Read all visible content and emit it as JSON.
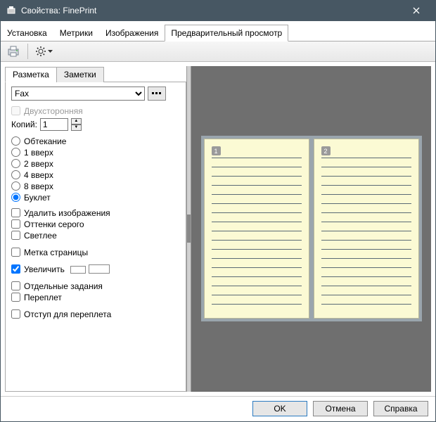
{
  "titlebar": {
    "title": "Свойства: FinePrint"
  },
  "tabs": {
    "install": "Установка",
    "metrics": "Метрики",
    "images": "Изображения",
    "preview": "Предварительный просмотр"
  },
  "sub_tabs": {
    "layout": "Разметка",
    "notes": "Заметки"
  },
  "form": {
    "preset_selected": "Fax",
    "preset_options": [
      "Fax"
    ],
    "duplex": "Двухсторонняя",
    "copies_label": "Копий:",
    "copies_value": "1",
    "layout_options": {
      "wrap": "Обтекание",
      "up1": "1 вверх",
      "up2": "2 вверх",
      "up4": "4 вверх",
      "up8": "8 вверх",
      "booklet": "Буклет",
      "selected": "booklet"
    },
    "remove_images": "Удалить изображения",
    "grayscale": "Оттенки серого",
    "lighter": "Светлее",
    "page_mark": "Метка страницы",
    "enlarge": "Увеличить",
    "enlarge_checked": true,
    "separate_jobs": "Отдельные задания",
    "binding": "Переплет",
    "binding_margin": "Отступ для переплета"
  },
  "preview": {
    "page1_num": "1",
    "page2_num": "2"
  },
  "footer": {
    "ok": "OK",
    "cancel": "Отмена",
    "help": "Справка"
  }
}
